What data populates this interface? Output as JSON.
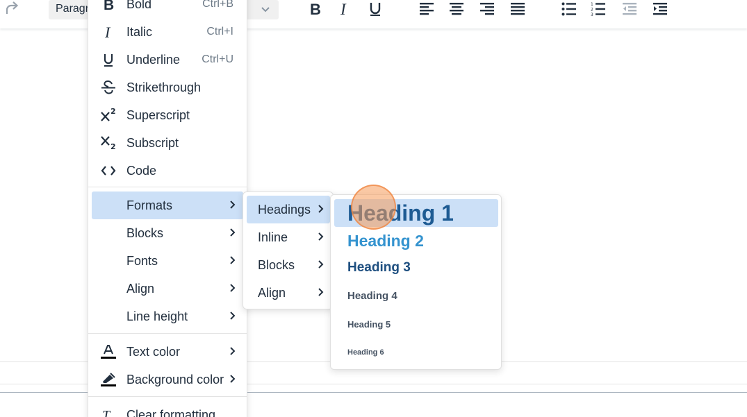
{
  "colors": {
    "active_bg": "#cce0f7",
    "heading1": "#1e5b93",
    "heading2": "#3493cf",
    "heading3": "#1e4f80",
    "heading_small": "#465363",
    "cursor_highlight": "#f59b5a"
  },
  "toolbar": {
    "blocks_value": "Paragr",
    "buttons": [
      "redo-icon",
      "bold-icon",
      "italic-icon",
      "underline-icon",
      "align-left-icon",
      "align-center-icon",
      "align-right-icon",
      "justify-icon",
      "bullet-list-icon",
      "numbered-list-icon",
      "outdent-icon",
      "indent-icon"
    ]
  },
  "format_menu": {
    "items": [
      {
        "label": "Bold",
        "shortcut": "Ctrl+B",
        "icon": "bold-icon"
      },
      {
        "label": "Italic",
        "shortcut": "Ctrl+I",
        "icon": "italic-icon"
      },
      {
        "label": "Underline",
        "shortcut": "Ctrl+U",
        "icon": "underline-icon"
      },
      {
        "label": "Strikethrough",
        "icon": "strikethrough-icon"
      },
      {
        "label": "Superscript",
        "icon": "superscript-icon"
      },
      {
        "label": "Subscript",
        "icon": "subscript-icon"
      },
      {
        "label": "Code",
        "icon": "code-icon"
      },
      {
        "label": "Formats"
      },
      {
        "label": "Blocks"
      },
      {
        "label": "Fonts"
      },
      {
        "label": "Align"
      },
      {
        "label": "Line height"
      },
      {
        "label": "Text color",
        "icon": "text-color-icon"
      },
      {
        "label": "Background color",
        "icon": "background-color-icon"
      },
      {
        "label": "Clear formatting",
        "icon": "clear-formatting-icon"
      }
    ]
  },
  "formats_menu": {
    "items": [
      {
        "label": "Headings"
      },
      {
        "label": "Inline"
      },
      {
        "label": "Blocks"
      },
      {
        "label": "Align"
      }
    ]
  },
  "headings_menu": {
    "items": [
      {
        "label": "Heading 1"
      },
      {
        "label": "Heading 2"
      },
      {
        "label": "Heading 3"
      },
      {
        "label": "Heading 4"
      },
      {
        "label": "Heading 5"
      },
      {
        "label": "Heading 6"
      }
    ]
  }
}
